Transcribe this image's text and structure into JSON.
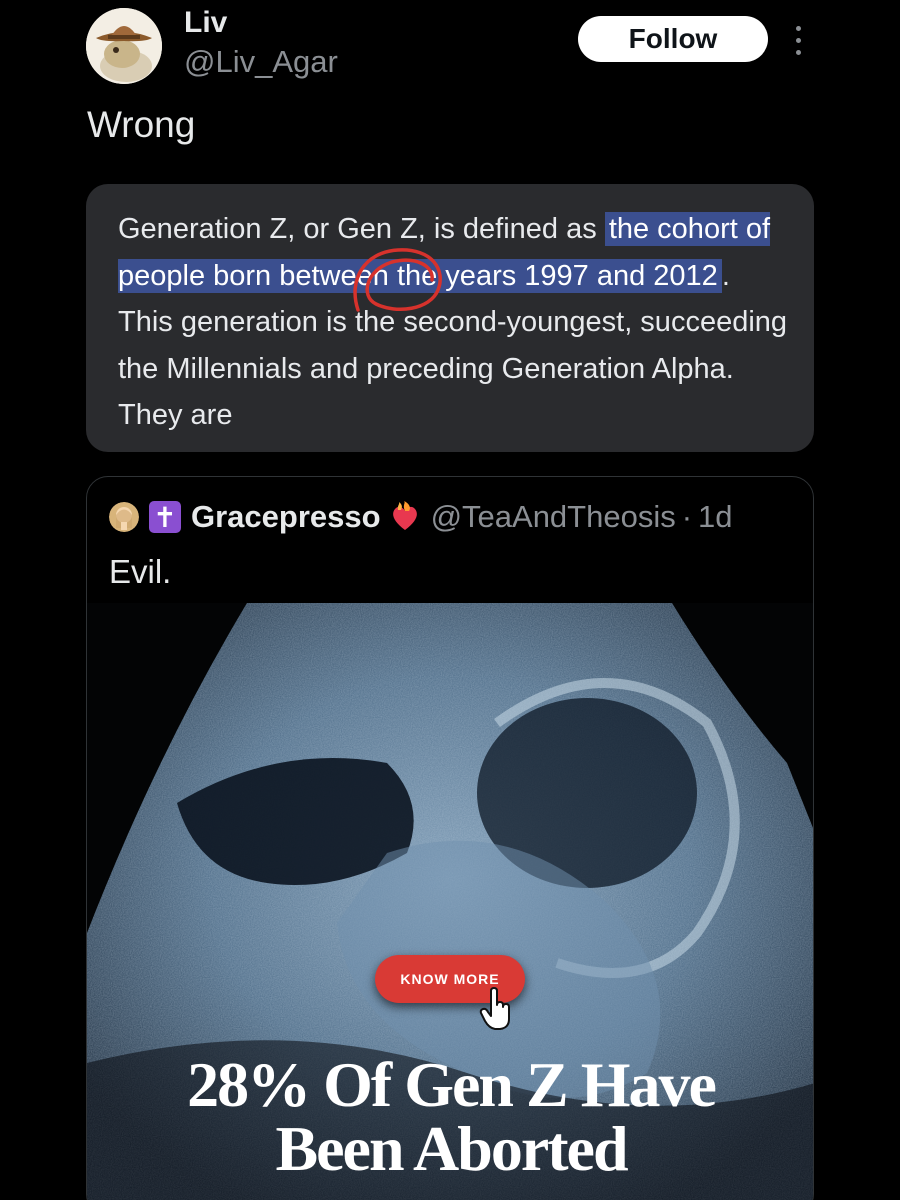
{
  "author": {
    "name": "Liv",
    "handle": "@Liv_Agar"
  },
  "actions": {
    "follow_label": "Follow"
  },
  "tweet": {
    "text": "Wrong"
  },
  "snippet": {
    "before": "Generation Z, or Gen Z, is defined as ",
    "highlight": "the cohort of people born between the years 1997 and 2012",
    "after": ". This generation is the second-youngest, succeeding the Millennials and preceding Generation Alpha. They are"
  },
  "quoted": {
    "name": "Gracepresso",
    "handle": "@TeaAndTheosis",
    "separator": "·",
    "time": "1d",
    "text": "Evil.",
    "media": {
      "button_label": "KNOW MORE",
      "headline_line1": "28% Of Gen Z Have",
      "headline_line2": "Been Aborted"
    }
  },
  "colors": {
    "background": "#000000",
    "highlight": "#3b4f8f",
    "annotation_red": "#d7322c",
    "verified_purple": "#8a4fd1"
  },
  "icons": {
    "avatar": "cowboy-frog-avatar",
    "more": "three-dots-vertical-icon",
    "quoted_badges": [
      "praying-woman-emoji",
      "latin-cross-emoji",
      "heart-on-fire-emoji"
    ],
    "cursor": "hand-pointer-icon"
  }
}
